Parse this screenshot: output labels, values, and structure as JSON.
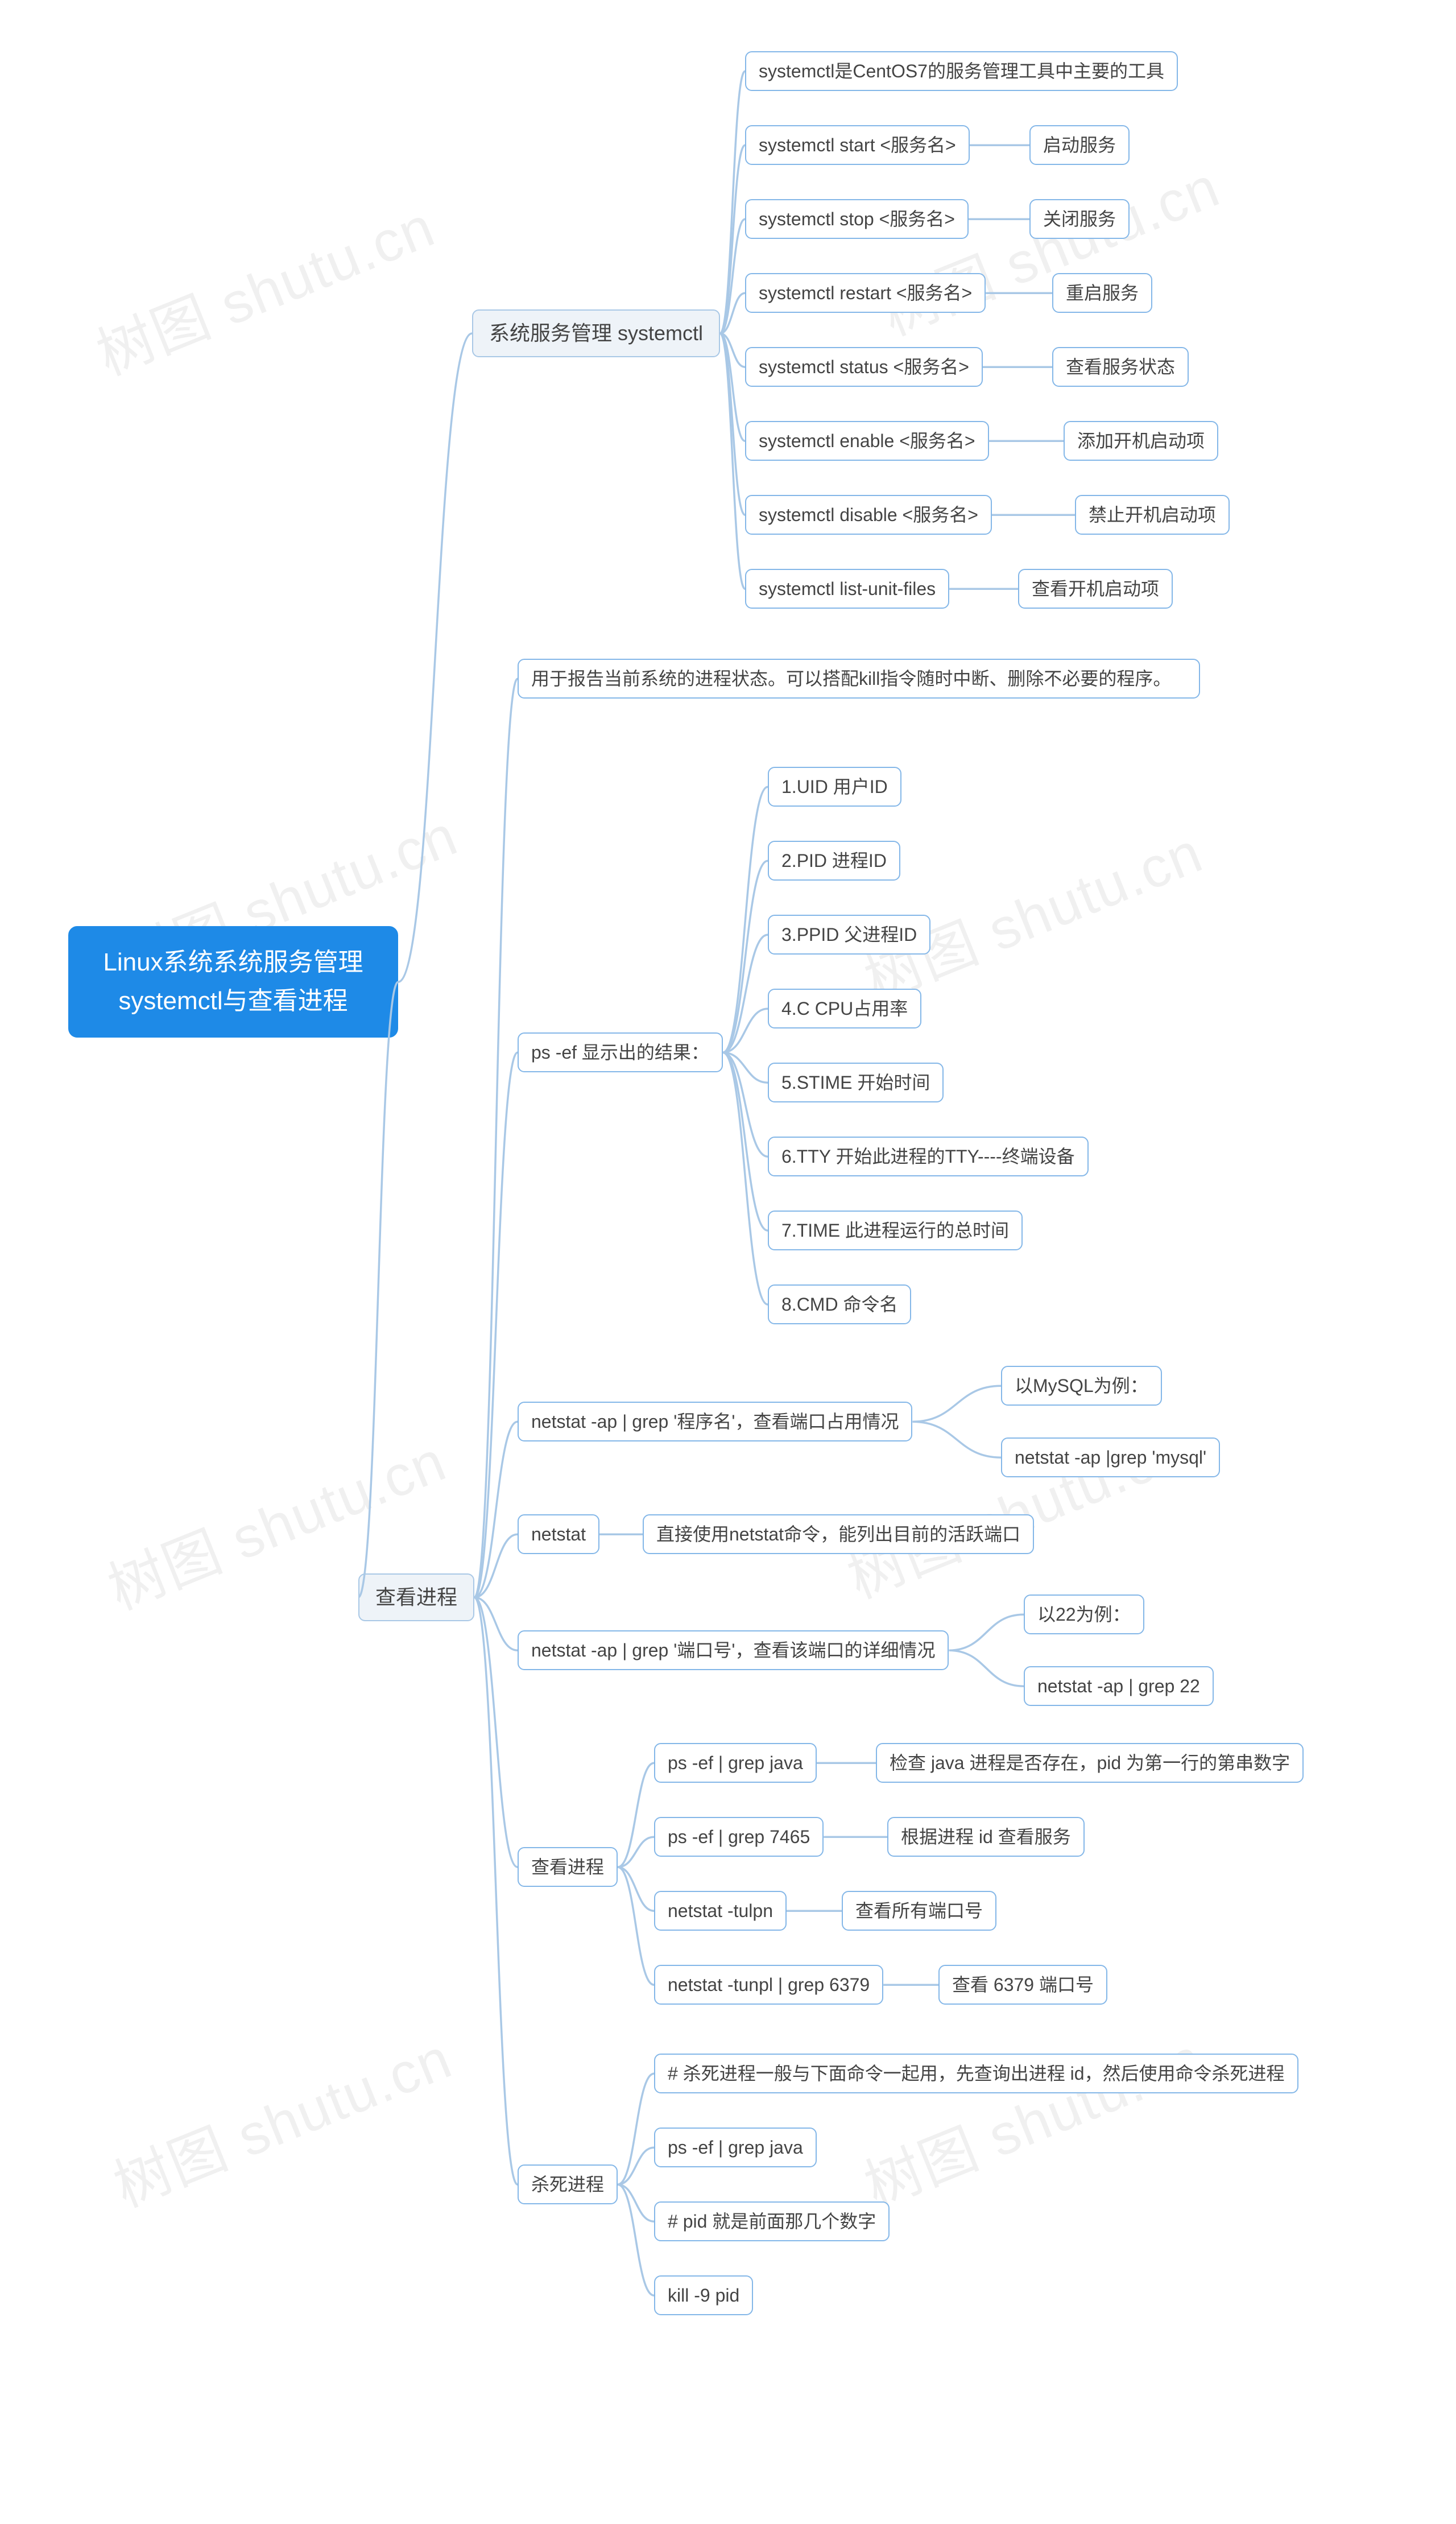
{
  "watermark_text": "树图 shutu.cn",
  "root": {
    "title": "Linux系统系统服务管理\nsystemctl与查看进程"
  },
  "b1": {
    "title": "系统服务管理 systemctl",
    "desc": "systemctl是CentOS7的服务管理工具中主要的工具",
    "cmds": [
      {
        "cmd": "systemctl start <服务名>",
        "note": "启动服务"
      },
      {
        "cmd": "systemctl stop <服务名>",
        "note": "关闭服务"
      },
      {
        "cmd": "systemctl restart <服务名>",
        "note": "重启服务"
      },
      {
        "cmd": "systemctl status <服务名>",
        "note": "查看服务状态"
      },
      {
        "cmd": "systemctl enable <服务名>",
        "note": "添加开机启动项"
      },
      {
        "cmd": "systemctl disable <服务名>",
        "note": "禁止开机启动项"
      },
      {
        "cmd": "systemctl list-unit-files",
        "note": "查看开机启动项"
      }
    ]
  },
  "b2": {
    "title": "查看进程",
    "desc": "用于报告当前系统的进程状态。可以搭配kill指令随时中断、删除不必要的程序。",
    "psResults": {
      "title": "ps -ef 显示出的结果：",
      "items": [
        "1.UID 用户ID",
        "2.PID 进程ID",
        "3.PPID 父进程ID",
        "4.C CPU占用率",
        "5.STIME 开始时间",
        "6.TTY 开始此进程的TTY----终端设备",
        "7.TIME 此进程运行的总时间",
        "8.CMD 命令名"
      ]
    },
    "netstatName": {
      "cmd": "netstat -ap | grep '程序名'，查看端口占用情况",
      "ex_label": "以MySQL为例：",
      "ex_cmd": "netstat -ap |grep 'mysql'"
    },
    "netstatPlain": {
      "cmd": "netstat",
      "note": "直接使用netstat命令，能列出目前的活跃端口"
    },
    "netstatPort": {
      "cmd": "netstat -ap | grep '端口号'，查看该端口的详细情况",
      "ex_label": "以22为例：",
      "ex_cmd": "netstat -ap | grep 22"
    },
    "viewProc": {
      "title": "查看进程",
      "rows": [
        {
          "cmd": "ps -ef | grep java",
          "note": "检查 java 进程是否存在，pid 为第一行的第串数字"
        },
        {
          "cmd": "ps -ef | grep 7465",
          "note": "根据进程 id 查看服务"
        },
        {
          "cmd": "netstat -tulpn",
          "note": "查看所有端口号"
        },
        {
          "cmd": "netstat -tunpl | grep 6379",
          "note": "查看 6379 端口号"
        }
      ]
    },
    "killProc": {
      "title": "杀死进程",
      "items": [
        "# 杀死进程一般与下面命令一起用，先查询出进程 id，然后使用命令杀死进程",
        "ps -ef | grep java",
        "# pid 就是前面那几个数字",
        "kill -9 pid"
      ]
    }
  }
}
